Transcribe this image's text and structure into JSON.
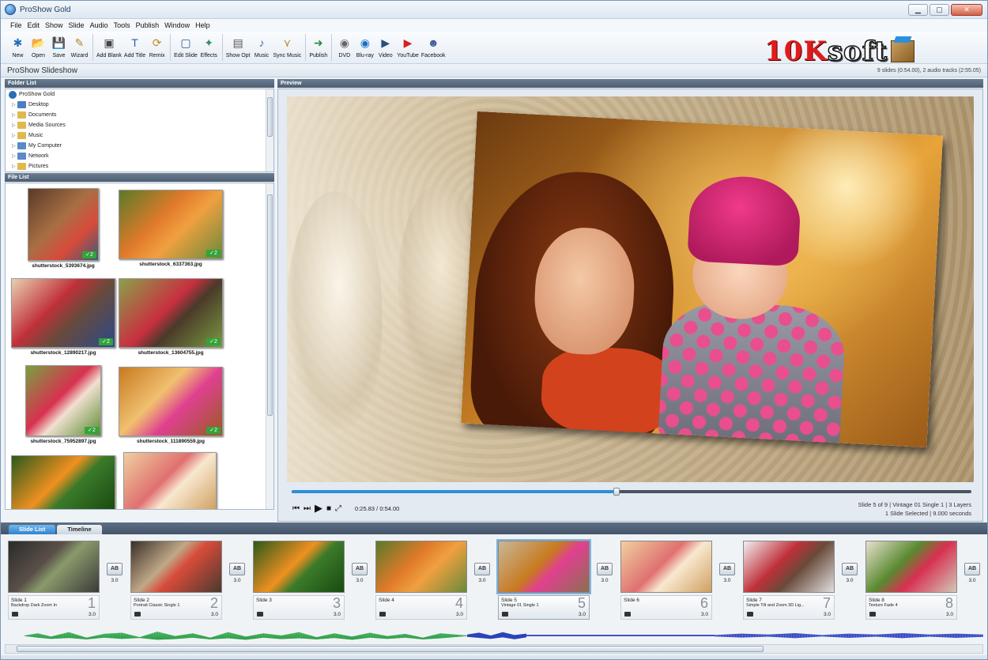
{
  "window": {
    "title": "ProShow Gold"
  },
  "menu": [
    "File",
    "Edit",
    "Show",
    "Slide",
    "Audio",
    "Tools",
    "Publish",
    "Window",
    "Help"
  ],
  "toolbar": {
    "group1": [
      {
        "label": "New",
        "icon": "new-icon",
        "glyph": "✱",
        "color": "#2a6db5"
      },
      {
        "label": "Open",
        "icon": "open-folder-icon",
        "glyph": "📂",
        "color": "#d9a12a"
      },
      {
        "label": "Save",
        "icon": "save-icon",
        "glyph": "💾",
        "color": "#3a5f90"
      },
      {
        "label": "Wizard",
        "icon": "wizard-icon",
        "glyph": "✎",
        "color": "#b5862a"
      }
    ],
    "group2": [
      {
        "label": "Add Blank",
        "icon": "add-blank-icon",
        "glyph": "▣",
        "color": "#444"
      },
      {
        "label": "Add Title",
        "icon": "add-title-icon",
        "glyph": "T",
        "color": "#2b5fa8"
      },
      {
        "label": "Remix",
        "icon": "remix-icon",
        "glyph": "⟳",
        "color": "#c08a20"
      }
    ],
    "group3": [
      {
        "label": "Edit Slide",
        "icon": "edit-slide-icon",
        "glyph": "▢",
        "color": "#2a5a8c"
      },
      {
        "label": "Effects",
        "icon": "effects-icon",
        "glyph": "✦",
        "color": "#3a8a70"
      }
    ],
    "group4": [
      {
        "label": "Show Opt",
        "icon": "show-options-icon",
        "glyph": "▤",
        "color": "#555"
      },
      {
        "label": "Music",
        "icon": "music-icon",
        "glyph": "♪",
        "color": "#3a6fb0"
      },
      {
        "label": "Sync Music",
        "icon": "sync-music-icon",
        "glyph": "⋎",
        "color": "#c08a20"
      }
    ],
    "group5": [
      {
        "label": "Publish",
        "icon": "publish-icon",
        "glyph": "➜",
        "color": "#2e8a3c"
      }
    ],
    "group6": [
      {
        "label": "DVD",
        "icon": "dvd-icon",
        "glyph": "◉",
        "color": "#666"
      },
      {
        "label": "Blu-ray",
        "icon": "bluray-icon",
        "glyph": "◉",
        "color": "#1a70c8"
      },
      {
        "label": "Video",
        "icon": "video-icon",
        "glyph": "▶",
        "color": "#2a4f7a"
      },
      {
        "label": "YouTube",
        "icon": "youtube-icon",
        "glyph": "▶",
        "color": "#d42020"
      },
      {
        "label": "Facebook",
        "icon": "facebook-icon",
        "glyph": "☻",
        "color": "#3b5998"
      }
    ]
  },
  "logo": {
    "part_a": "10K",
    "part_b": "soft"
  },
  "project": {
    "name": "ProShow Slideshow",
    "info": "9 slides (0:54.00), 2 audio tracks (2:55.05)"
  },
  "folder_list": {
    "header": "Folder List",
    "items": [
      {
        "label": "ProShow Gold",
        "color": "#2a6db5",
        "root": true
      },
      {
        "label": "Desktop",
        "color": "#4a7fc0"
      },
      {
        "label": "Documents",
        "color": "#e0b850"
      },
      {
        "label": "Media Sources",
        "color": "#e0b850"
      },
      {
        "label": "Music",
        "color": "#e0b850"
      },
      {
        "label": "My Computer",
        "color": "#5a8ac8"
      },
      {
        "label": "Network",
        "color": "#5a8ac8"
      },
      {
        "label": "Pictures",
        "color": "#e0b850"
      }
    ]
  },
  "file_list": {
    "header": "File List",
    "badge": "✓2",
    "files": [
      {
        "name": "shutterstock_5393674.jpg",
        "bg": "linear-gradient(135deg,#5a3a28,#a86f44 45%,#d84b3a 70%,#3a5a7a)"
      },
      {
        "name": "shutterstock_6337363.jpg",
        "bg": "linear-gradient(135deg,#5a7a2a,#e07a2a 40%,#f0a040 60%,#6a8a3a)"
      },
      {
        "name": "shutterstock_12890217.jpg",
        "bg": "linear-gradient(135deg,#e8d0b0,#c0303a 40%,#6a4a3a 60%,#2a4a8a)"
      },
      {
        "name": "shutterstock_13604755.jpg",
        "bg": "linear-gradient(135deg,#8aa04a,#c83040 45%,#4a3a2a 60%,#7a9a40)"
      },
      {
        "name": "shutterstock_75952897.jpg",
        "bg": "linear-gradient(135deg,#7aa040,#d83050 45%,#f0e0d0 60%,#5a8a30)"
      },
      {
        "name": "shutterstock_111890559.jpg",
        "bg": "linear-gradient(135deg,#c87a20,#f0c070 40%,#e04090 60%,#9a5a20)"
      },
      {
        "name": "",
        "bg": "linear-gradient(135deg,#2a5a1a,#f09020 45%,#3a7a2a 60%,#1a4a10)"
      },
      {
        "name": "",
        "bg": "linear-gradient(135deg,#f0d0a0,#e07070 45%,#f8e8d0 60%,#d0a060)"
      }
    ]
  },
  "preview": {
    "header": "Preview",
    "time": "0:25.83 / 0:54.00",
    "progress": 0.478,
    "slide_info": "Slide 5 of 9  |  Vintage 01 Single 1  |  3 Layers",
    "selection_info": "1 Slide Selected  |  9.000 seconds"
  },
  "tabs": [
    {
      "label": "Slide List",
      "active": true
    },
    {
      "label": "Timeline",
      "active": false
    }
  ],
  "slides": [
    {
      "name": "Slide 1",
      "effect": "Backdrop Dark Zoom In",
      "num": "1",
      "dur": "3.0",
      "bg": "linear-gradient(135deg,#2a2a2a,#5a5048 40%,#8a9a6a 55%,#3a3a3a)"
    },
    {
      "name": "Slide 2",
      "effect": "Portrait Classic Single 1",
      "num": "2",
      "dur": "3.0",
      "bg": "linear-gradient(135deg,#3a3028,#c0a888 40%,#d84b3a 55%,#4a3a30)"
    },
    {
      "name": "Slide 3",
      "effect": "",
      "num": "3",
      "dur": "3.0",
      "bg": "linear-gradient(135deg,#2a5a1a,#f09020 45%,#3a7a2a 60%,#1a4a10)"
    },
    {
      "name": "Slide 4",
      "effect": "",
      "num": "4",
      "dur": "3.0",
      "bg": "linear-gradient(135deg,#5a7a2a,#e07a2a 40%,#f0a040 60%,#6a8a3a)"
    },
    {
      "name": "Slide 5",
      "effect": "Vintage 01 Single 1",
      "num": "5",
      "dur": "3.0",
      "bg": "linear-gradient(135deg,#c8b898,#c87a20 45%,#e04090 60%,#8a7050)",
      "selected": true
    },
    {
      "name": "Slide 6",
      "effect": "",
      "num": "6",
      "dur": "3.0",
      "bg": "linear-gradient(135deg,#f0d0a0,#e07070 45%,#f8e8d0 60%,#d0a060)"
    },
    {
      "name": "Slide 7",
      "effect": "Simple Tilt and Zoom 3D Lig...",
      "num": "7",
      "dur": "3.0",
      "bg": "linear-gradient(135deg,#f0f0f0,#c0303a 40%,#6a4a3a 60%,#e0e0e0)"
    },
    {
      "name": "Slide 8",
      "effect": "Texture Fade 4",
      "num": "8",
      "dur": "3.0",
      "bg": "linear-gradient(135deg,#e8e0d0,#5a8a30 40%,#d83050 60%,#d0c8b8)"
    }
  ],
  "transitions": [
    {
      "label": "AB",
      "time": "3.0"
    },
    {
      "label": "AB",
      "time": "3.0"
    },
    {
      "label": "AB",
      "time": "3.0"
    },
    {
      "label": "AB",
      "time": "3.0"
    },
    {
      "label": "AB",
      "time": "3.0"
    },
    {
      "label": "AB",
      "time": "3.0"
    },
    {
      "label": "AB",
      "time": "3.0"
    },
    {
      "label": "AB",
      "time": "3.0"
    }
  ]
}
